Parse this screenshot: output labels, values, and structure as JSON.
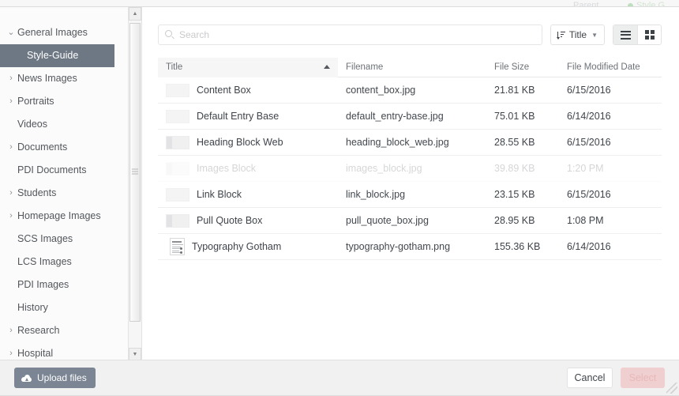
{
  "background": {
    "parent_label": "Parent",
    "status_label": "Style G",
    "status_dot_color": "#bddfbd"
  },
  "sidebar": {
    "items": [
      {
        "label": "General Images",
        "twisty": "⌄",
        "expanded": true,
        "child": false,
        "active": false
      },
      {
        "label": "Style-Guide",
        "twisty": "",
        "expanded": false,
        "child": true,
        "active": true
      },
      {
        "label": "News Images",
        "twisty": "›",
        "expanded": false,
        "child": false,
        "active": false
      },
      {
        "label": "Portraits",
        "twisty": "›",
        "expanded": false,
        "child": false,
        "active": false
      },
      {
        "label": "Videos",
        "twisty": "",
        "expanded": false,
        "child": false,
        "active": false
      },
      {
        "label": "Documents",
        "twisty": "›",
        "expanded": false,
        "child": false,
        "active": false
      },
      {
        "label": "PDI Documents",
        "twisty": "",
        "expanded": false,
        "child": false,
        "active": false
      },
      {
        "label": "Students",
        "twisty": "›",
        "expanded": false,
        "child": false,
        "active": false
      },
      {
        "label": "Homepage Images",
        "twisty": "›",
        "expanded": false,
        "child": false,
        "active": false
      },
      {
        "label": "SCS Images",
        "twisty": "",
        "expanded": false,
        "child": false,
        "active": false
      },
      {
        "label": "LCS Images",
        "twisty": "",
        "expanded": false,
        "child": false,
        "active": false
      },
      {
        "label": "PDI Images",
        "twisty": "",
        "expanded": false,
        "child": false,
        "active": false
      },
      {
        "label": "History",
        "twisty": "",
        "expanded": false,
        "child": false,
        "active": false
      },
      {
        "label": "Research",
        "twisty": "›",
        "expanded": false,
        "child": false,
        "active": false
      },
      {
        "label": "Hospital",
        "twisty": "›",
        "expanded": false,
        "child": false,
        "active": false
      }
    ],
    "active_background": "#6e7885"
  },
  "toolbar": {
    "search_placeholder": "Search",
    "search_value": "",
    "sort_label": "Title",
    "sort_direction": "ascending",
    "view_list_active": true,
    "view_grid_active": false
  },
  "table": {
    "columns": [
      {
        "key": "title",
        "label": "Title",
        "sorted": true
      },
      {
        "key": "filename",
        "label": "Filename",
        "sorted": false
      },
      {
        "key": "size",
        "label": "File Size",
        "sorted": false
      },
      {
        "key": "date",
        "label": "File Modified Date",
        "sorted": false
      }
    ],
    "rows": [
      {
        "title": "Content Box",
        "filename": "content_box.jpg",
        "size": "21.81 KB",
        "date": "6/15/2016",
        "thumb": "flat",
        "faded": false
      },
      {
        "title": "Default Entry Base",
        "filename": "default_entry-base.jpg",
        "size": "75.01 KB",
        "date": "6/14/2016",
        "thumb": "flat",
        "faded": false
      },
      {
        "title": "Heading Block Web",
        "filename": "heading_block_web.jpg",
        "size": "28.55 KB",
        "date": "6/15/2016",
        "thumb": "barred",
        "faded": false
      },
      {
        "title": "Images Block",
        "filename": "images_block.jpg",
        "size": "39.89 KB",
        "date": "1:20 PM",
        "thumb": "barred",
        "faded": true
      },
      {
        "title": "Link Block",
        "filename": "link_block.jpg",
        "size": "23.15 KB",
        "date": "6/15/2016",
        "thumb": "flat",
        "faded": false
      },
      {
        "title": "Pull Quote Box",
        "filename": "pull_quote_box.jpg",
        "size": "28.95 KB",
        "date": "1:08 PM",
        "thumb": "barred",
        "faded": false
      },
      {
        "title": "Typography Gotham",
        "filename": "typography-gotham.png",
        "size": "155.36 KB",
        "date": "6/14/2016",
        "thumb": "doc",
        "faded": false
      }
    ]
  },
  "footer": {
    "upload_label": "Upload files",
    "cancel_label": "Cancel",
    "select_label": "Select",
    "select_disabled": true,
    "upload_color": "#7b8593",
    "select_color": "#f0cfd0"
  }
}
